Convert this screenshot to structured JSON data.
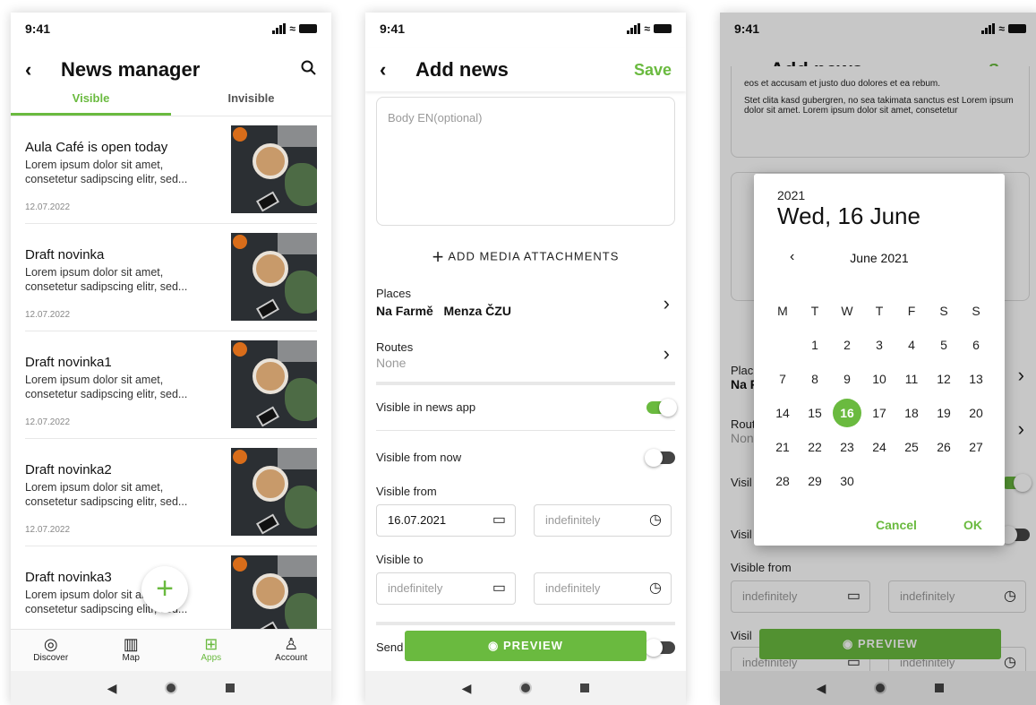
{
  "colors": {
    "accent": "#6aba3f"
  },
  "status": {
    "time": "9:41"
  },
  "screen1": {
    "back_icon": "‹",
    "title": "News manager",
    "search_icon": "search-icon",
    "tabs": [
      {
        "label": "Visible"
      },
      {
        "label": "Invisible"
      }
    ],
    "news": [
      {
        "title": "Aula Café is open today",
        "desc": "Lorem ipsum dolor sit amet, consetetur sadipscing elitr, sed...",
        "date": "12.07.2022"
      },
      {
        "title": "Draft novinka",
        "desc": "Lorem ipsum dolor sit amet, consetetur sadipscing elitr, sed...",
        "date": "12.07.2022"
      },
      {
        "title": "Draft novinka1",
        "desc": "Lorem ipsum dolor sit amet, consetetur sadipscing elitr, sed...",
        "date": "12.07.2022"
      },
      {
        "title": "Draft novinka2",
        "desc": "Lorem ipsum dolor sit amet, consetetur sadipscing elitr, sed...",
        "date": "12.07.2022"
      },
      {
        "title": "Draft novinka3",
        "desc": "Lorem ipsum dolor sit amet, consetetur sadipscing elitr, sed...",
        "date": ""
      }
    ],
    "fab": "+",
    "nav": [
      {
        "label": "Discover",
        "icon": "discover-icon"
      },
      {
        "label": "Map",
        "icon": "map-icon"
      },
      {
        "label": "Apps",
        "icon": "apps-icon"
      },
      {
        "label": "Account",
        "icon": "account-icon"
      }
    ]
  },
  "screen2": {
    "title": "Add news",
    "save": "Save",
    "body_placeholder": "Body EN(optional)",
    "add_media": "ADD MEDIA ATTACHMENTS",
    "places_label": "Places",
    "places_value": "Na Farmě   Menza ČZU",
    "routes_label": "Routes",
    "routes_value": "None",
    "visible_in_app": "Visible in news app",
    "visible_from_now": "Visible from now",
    "visible_from": "Visible from",
    "visible_from_date": "16.07.2021",
    "visible_from_time": "indefinitely",
    "visible_to": "Visible to",
    "visible_to_date": "indefinitely",
    "visible_to_time": "indefinitely",
    "send_label": "Send",
    "preview": "PREVIEW"
  },
  "screen3": {
    "title": "Add news",
    "save": "Save",
    "body_text1": "eos et accusam et justo duo dolores et ea rebum.",
    "body_text2": "Stet clita kasd gubergren, no sea takimata sanctus est Lorem ipsum dolor sit amet. Lorem ipsum dolor sit amet, consetetur",
    "places_label": "Plac",
    "places_value": "Na F",
    "routes_label": "Rout",
    "routes_value": "Non",
    "visible_label": "Visil",
    "visible2_label": "Visil",
    "visible_from": "Visible from",
    "vf_date": "indefinitely",
    "vf_time": "indefinitely",
    "visible_to_label": "Visil",
    "vt_date": "indefinitely",
    "vt_time": "indefinitely",
    "preview": "PREVIEW",
    "picker": {
      "year": "2021",
      "date": "Wed, 16 June",
      "month": "June 2021",
      "weekdays": [
        "M",
        "T",
        "W",
        "T",
        "F",
        "S",
        "S"
      ],
      "days": [
        "",
        "1",
        "2",
        "3",
        "4",
        "5",
        "6",
        "7",
        "8",
        "9",
        "10",
        "11",
        "12",
        "13",
        "14",
        "15",
        "16",
        "17",
        "18",
        "19",
        "20",
        "21",
        "22",
        "23",
        "24",
        "25",
        "26",
        "27",
        "28",
        "29",
        "30"
      ],
      "selected": "16",
      "cancel": "Cancel",
      "ok": "OK"
    }
  }
}
